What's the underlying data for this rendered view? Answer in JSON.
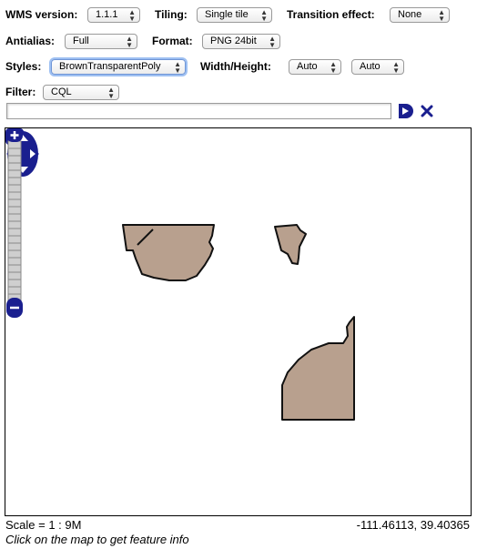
{
  "toolbar": {
    "wms_version": {
      "label": "WMS version:",
      "value": "1.1.1"
    },
    "tiling": {
      "label": "Tiling:",
      "value": "Single tile"
    },
    "transition": {
      "label": "Transition effect:",
      "value": "None"
    },
    "antialias": {
      "label": "Antialias:",
      "value": "Full"
    },
    "format": {
      "label": "Format:",
      "value": "PNG 24bit"
    },
    "styles": {
      "label": "Styles:",
      "value": "BrownTransparentPoly"
    },
    "size": {
      "label": "Width/Height:",
      "width_value": "Auto",
      "height_value": "Auto"
    },
    "filter": {
      "label": "Filter:",
      "value": "CQL",
      "input_value": ""
    }
  },
  "icons": {
    "apply": "play-icon",
    "clear": "close-icon",
    "layers": "layer-switcher-icon",
    "pan": "pan-arrows-icon",
    "zoom_in": "zoom-in-icon",
    "zoom_out": "zoom-out-icon"
  },
  "colors": {
    "control_navy": "#1a1f8f",
    "polygon_fill": "#b8a08e",
    "polygon_stroke": "#111111",
    "focus_ring": "#9ec0f2"
  },
  "footer": {
    "scale": "Scale = 1 : 9M",
    "coordinates": "-111.46113, 39.40365",
    "hint": "Click on the map to get feature info"
  }
}
